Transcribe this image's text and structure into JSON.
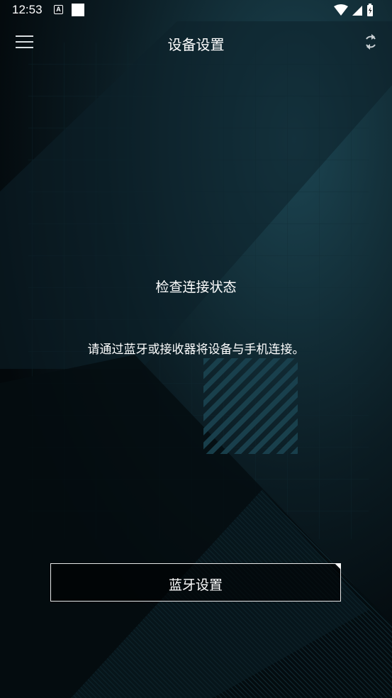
{
  "status_bar": {
    "time": "12:53",
    "notification_icon": "A"
  },
  "app_bar": {
    "title": "设备设置",
    "menu_icon": "hamburger-menu-icon",
    "refresh_icon": "sync-icon"
  },
  "main": {
    "status_title": "检查连接状态",
    "status_message": "请通过蓝牙或接收器将设备与手机连接。",
    "bluetooth_button_label": "蓝牙设置"
  },
  "colors": {
    "background": "#03080b",
    "accent_teal": "#1d4b57",
    "text": "#ffffff"
  }
}
